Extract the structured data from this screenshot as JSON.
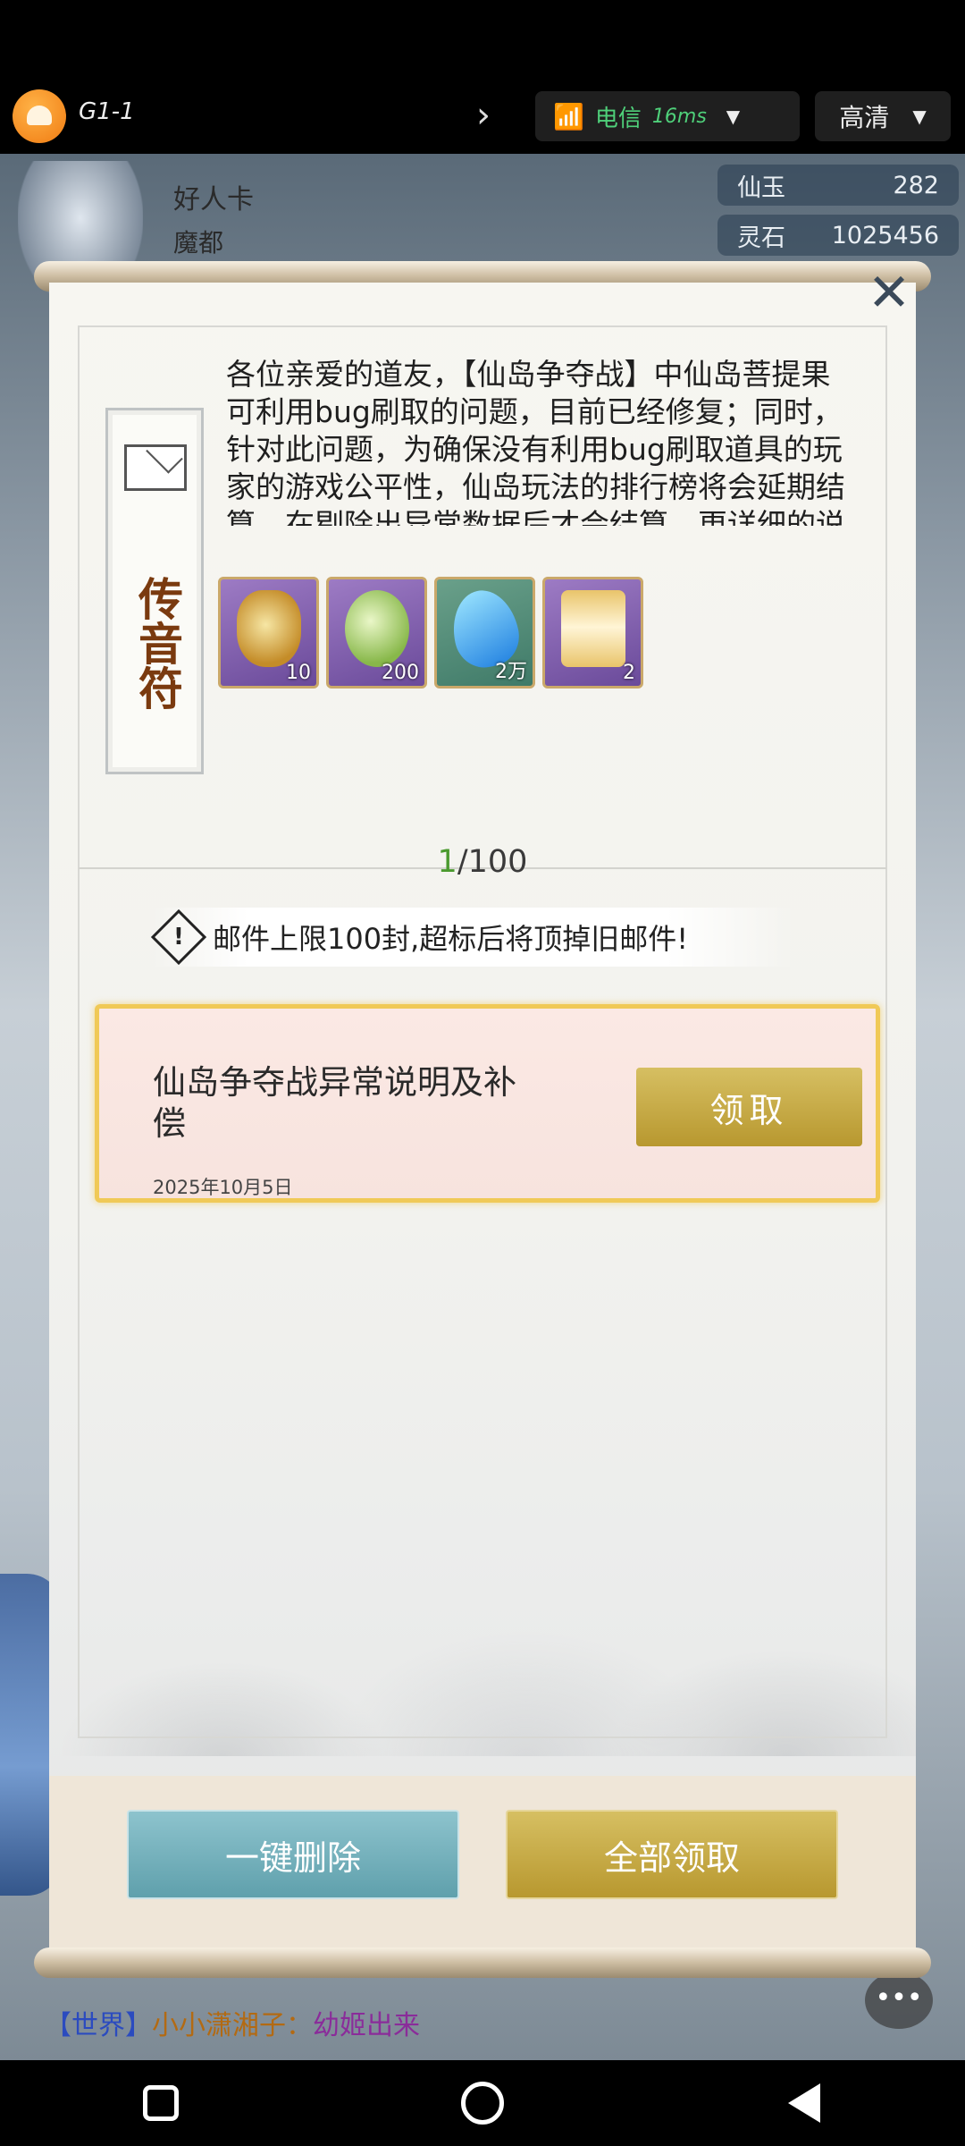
{
  "topbar": {
    "app_title": "G1-1",
    "network": "电信",
    "latency": "16ms",
    "quality": "高清"
  },
  "player": {
    "name": "好人卡",
    "location": "魔都"
  },
  "resources": [
    {
      "label": "仙玉",
      "value": "282"
    },
    {
      "label": "灵石",
      "value": "1025456"
    }
  ],
  "mail_detail": {
    "stamp_text": "传音符",
    "body": "各位亲爱的道友，【仙岛争夺战】中仙岛菩提果可利用bug刷取的问题，目前已经修复；同时，针对此问题，为确保没有利用bug刷取道具的玩家的游戏公平性，仙岛玩法的排行榜将会延期结算，在剔除出异常数据后才会结算，更详细的说",
    "rewards": [
      {
        "icon": "pouch-icon",
        "qty": "10"
      },
      {
        "icon": "jade-icon",
        "qty": "200"
      },
      {
        "icon": "crystal-icon",
        "qty": "2万"
      },
      {
        "icon": "hourglass-icon",
        "qty": "2"
      }
    ]
  },
  "mailbox": {
    "count_current": "1",
    "count_max": "/100",
    "warning": "邮件上限100封,超标后将顶掉旧邮件!",
    "mails": [
      {
        "title": "仙岛争夺战异常说明及补偿",
        "date": "2025年10月5日",
        "action": "领取"
      }
    ]
  },
  "buttons": {
    "delete_all": "一键删除",
    "claim_all": "全部领取"
  },
  "chat": {
    "channel": "【世界】",
    "user": "小小潇湘子：",
    "message": "幼姬出来"
  },
  "colors": {
    "gold_button": "#c9ab45",
    "teal_button": "#77b3be",
    "card_border": "#f0c957",
    "count_highlight": "#4a9a2e"
  }
}
